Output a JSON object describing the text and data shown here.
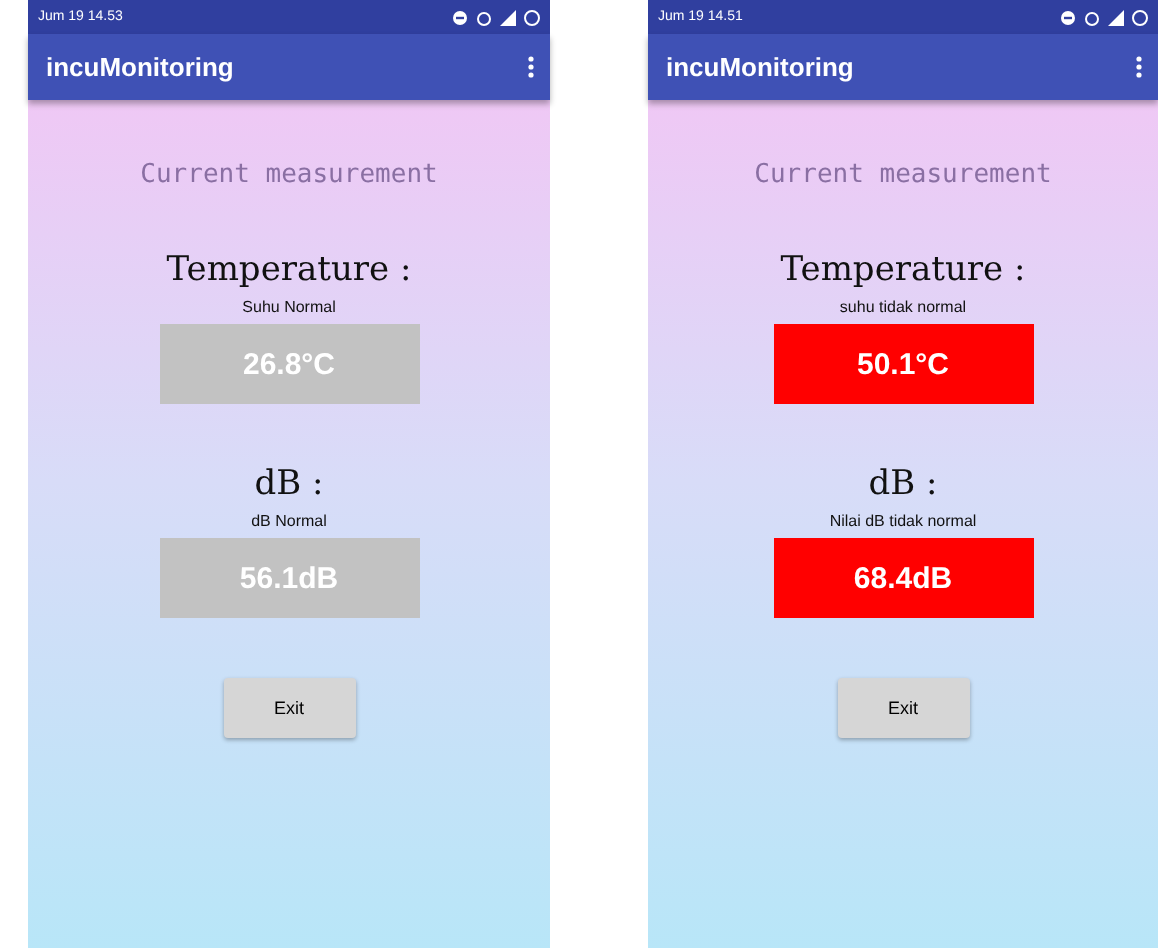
{
  "phones": [
    {
      "status_bar": {
        "time": "Jum 19 14.53"
      },
      "app_bar": {
        "title": "incuMonitoring"
      },
      "heading": "Current measurement",
      "readings": [
        {
          "label": "Temperature :",
          "status": "Suhu Normal",
          "value": "26.8°C",
          "alert": false
        },
        {
          "label": "dB :",
          "status": "dB Normal",
          "value": "56.1dB",
          "alert": false
        }
      ],
      "exit_button": "Exit"
    },
    {
      "status_bar": {
        "time": "Jum 19 14.51"
      },
      "app_bar": {
        "title": "incuMonitoring"
      },
      "heading": "Current measurement",
      "readings": [
        {
          "label": "Temperature :",
          "status": "suhu tidak normal",
          "value": "50.1°C",
          "alert": true
        },
        {
          "label": "dB :",
          "status": "Nilai dB tidak normal",
          "value": "68.4dB",
          "alert": true
        }
      ],
      "exit_button": "Exit"
    }
  ]
}
